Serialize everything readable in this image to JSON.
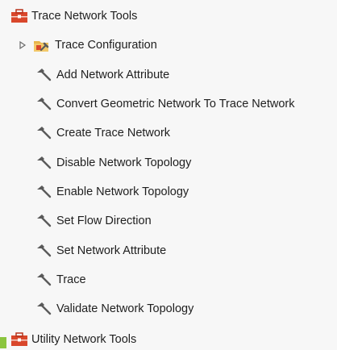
{
  "tree": {
    "items": [
      {
        "label": "Trace Network Tools",
        "icon": "toolbox-icon"
      },
      {
        "label": "Trace Configuration",
        "icon": "toolset-icon",
        "expander": "expand-triangle-icon"
      },
      {
        "label": "Add Network Attribute",
        "icon": "hammer-icon"
      },
      {
        "label": "Convert Geometric Network To Trace Network",
        "icon": "hammer-icon"
      },
      {
        "label": "Create Trace Network",
        "icon": "hammer-icon"
      },
      {
        "label": "Disable Network Topology",
        "icon": "hammer-icon"
      },
      {
        "label": "Enable Network Topology",
        "icon": "hammer-icon"
      },
      {
        "label": "Set Flow Direction",
        "icon": "hammer-icon"
      },
      {
        "label": "Set Network Attribute",
        "icon": "hammer-icon"
      },
      {
        "label": "Trace",
        "icon": "hammer-icon"
      },
      {
        "label": "Validate Network Topology",
        "icon": "hammer-icon"
      },
      {
        "label": "Utility Network Tools",
        "icon": "toolbox-icon"
      }
    ]
  },
  "colors": {
    "toolbox": "#d9472b",
    "toolset_folder": "#e8b64c",
    "hammer": "#5a5a5a",
    "accent": "#8bc53f"
  }
}
